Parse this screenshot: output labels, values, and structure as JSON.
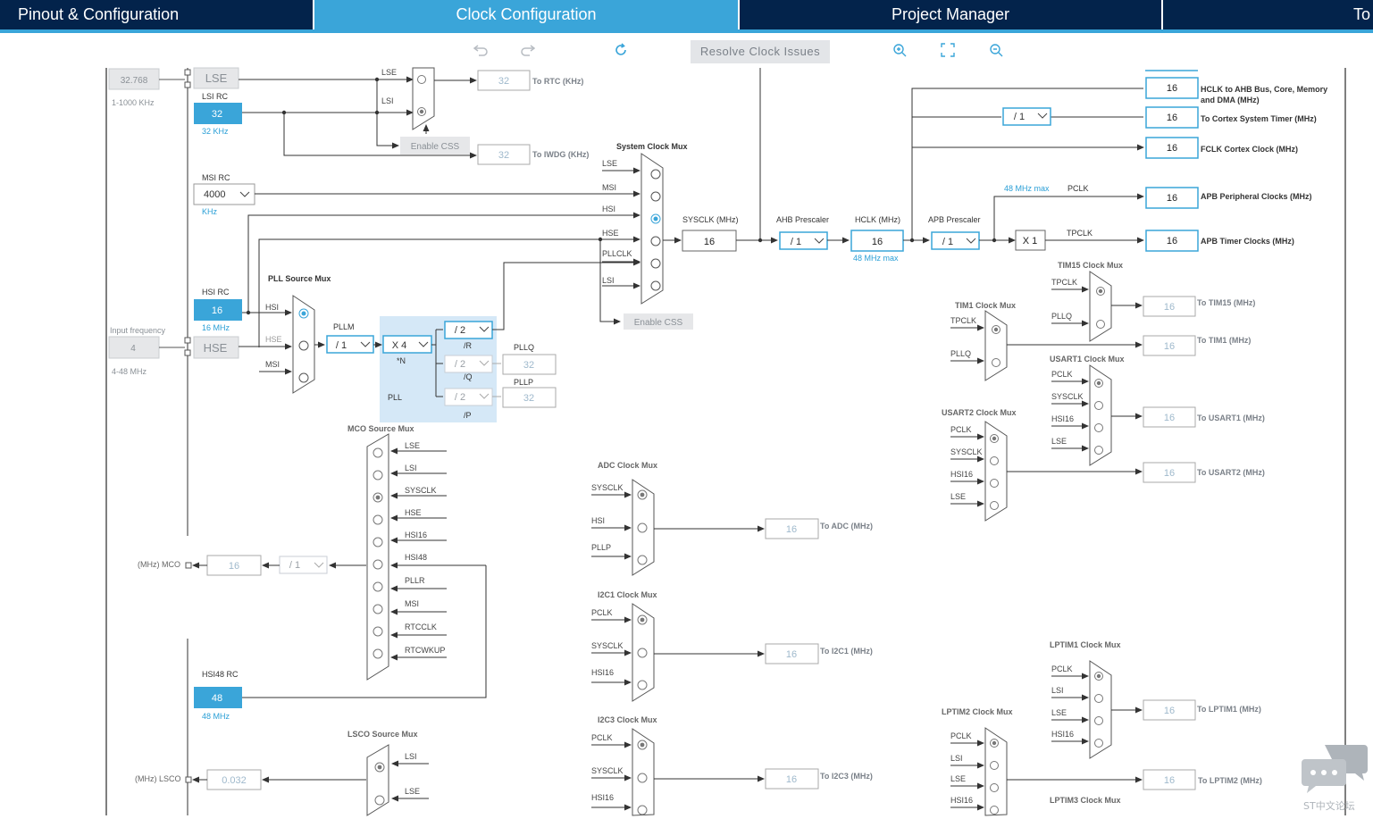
{
  "tabs": [
    {
      "label": "Pinout & Configuration",
      "active": false
    },
    {
      "label": "Clock Configuration",
      "active": true
    },
    {
      "label": "Project Manager",
      "active": false
    },
    {
      "label": "To",
      "active": false
    }
  ],
  "toolbar": {
    "undo_icon": "undo-icon",
    "redo_icon": "redo-icon",
    "reset_icon": "refresh-icon",
    "resolve_label": "Resolve Clock Issues",
    "zoom_in_icon": "zoom-in-icon",
    "fit_icon": "fit-screen-icon",
    "zoom_out_icon": "zoom-out-icon"
  },
  "sources": {
    "lse_value": "32.768",
    "lse_range": "1-1000 KHz",
    "lse_label": "LSE",
    "lsi_title": "LSI RC",
    "lsi_value": "32",
    "lsi_unit": "32 KHz",
    "msi_title": "MSI RC",
    "msi_value": "4000",
    "msi_unit": "KHz",
    "hsi_title": "HSI RC",
    "hsi_value": "16",
    "hsi_unit": "16 MHz",
    "input_freq_label": "Input frequency",
    "hse_value": "4",
    "hse_label": "HSE",
    "hse_range": "4-48 MHz",
    "hsi48_title": "HSI48 RC",
    "hsi48_value": "48",
    "hsi48_unit": "48 MHz"
  },
  "rtc": {
    "lse": "LSE",
    "lsi": "LSI",
    "value": "32",
    "label": "To RTC (KHz)",
    "enable_css": "Enable CSS",
    "iwdg_value": "32",
    "iwdg_label": "To IWDG (KHz)"
  },
  "sysmux": {
    "title": "System Clock Mux",
    "inputs": [
      "LSE",
      "MSI",
      "HSI",
      "HSE",
      "PLLCLK",
      "LSI"
    ],
    "enable_css": "Enable CSS"
  },
  "pll": {
    "src_title": "PLL Source Mux",
    "src_inputs": [
      "HSI",
      "HSE",
      "MSI"
    ],
    "pllm_label": "PLLM",
    "pllm_value": "/ 1",
    "pll_label": "PLL",
    "n_value": "X 4",
    "n_label": "*N",
    "r_value": "/ 2",
    "r_label": "/R",
    "q_value": "/ 2",
    "q_label": "/Q",
    "p_value": "/ 2",
    "p_label": "/P",
    "pllq_label": "PLLQ",
    "pllq_value": "32",
    "pllp_label": "PLLP",
    "pllp_value": "32"
  },
  "main": {
    "sysclk_label": "SYSCLK (MHz)",
    "sysclk_value": "16",
    "ahb_label": "AHB Prescaler",
    "ahb_value": "/ 1",
    "hclk_label": "HCLK (MHz)",
    "hclk_value": "16",
    "hclk_max": "48 MHz max",
    "apb_label": "APB Prescaler",
    "apb_value": "/ 1",
    "x1_label": "X 1",
    "pclk_max": "48 MHz max",
    "pclk": "PCLK",
    "tpclk": "TPCLK",
    "cortex_div": "/ 1"
  },
  "outputs": [
    {
      "value": "16",
      "label": "HCLK to AHB Bus, Core, Memory",
      "label2": "and DMA (MHz)"
    },
    {
      "value": "16",
      "label": "To Cortex System Timer (MHz)",
      "label2": ""
    },
    {
      "value": "16",
      "label": "FCLK Cortex Clock (MHz)",
      "label2": ""
    },
    {
      "value": "16",
      "label": "APB Peripheral Clocks (MHz)",
      "label2": ""
    },
    {
      "value": "16",
      "label": "APB Timer Clocks (MHz)",
      "label2": ""
    }
  ],
  "timers": {
    "tim15_title": "TIM15 Clock Mux",
    "tim15_inputs": [
      "TPCLK",
      "PLLQ"
    ],
    "tim15_value": "16",
    "tim15_label": "To TIM15 (MHz)",
    "tim1_title": "TIM1 Clock Mux",
    "tim1_inputs": [
      "TPCLK",
      "PLLQ"
    ],
    "tim1_value": "16",
    "tim1_label": "To TIM1 (MHz)",
    "usart1_title": "USART1 Clock Mux",
    "usart1_inputs": [
      "PCLK",
      "SYSCLK",
      "HSI16",
      "LSE"
    ],
    "usart1_value": "16",
    "usart1_label": "To USART1 (MHz)",
    "usart2_title": "USART2 Clock Mux",
    "usart2_inputs": [
      "PCLK",
      "SYSCLK",
      "HSI16",
      "LSE"
    ],
    "usart2_value": "16",
    "usart2_label": "To USART2 (MHz)",
    "lptim1_title": "LPTIM1 Clock Mux",
    "lptim1_inputs": [
      "PCLK",
      "LSI",
      "LSE",
      "HSI16"
    ],
    "lptim1_value": "16",
    "lptim1_label": "To LPTIM1 (MHz)",
    "lptim2_title": "LPTIM2 Clock Mux",
    "lptim2_inputs": [
      "PCLK",
      "LSI",
      "LSE",
      "HSI16"
    ],
    "lptim2_value": "16",
    "lptim2_label": "To LPTIM2 (MHz)",
    "lptim3_title": "LPTIM3 Clock Mux"
  },
  "mco": {
    "title": "MCO Source Mux",
    "inputs": [
      "LSE",
      "LSI",
      "SYSCLK",
      "HSE",
      "HSI16",
      "HSI48",
      "PLLR",
      "MSI",
      "RTCCLK",
      "RTCWKUP"
    ],
    "out_label": "(MHz) MCO",
    "out_value": "16",
    "div_value": "/ 1"
  },
  "lsco": {
    "title": "LSCO Source Mux",
    "inputs": [
      "LSI",
      "LSE"
    ],
    "out_label": "(MHz) LSCO",
    "out_value": "0.032"
  },
  "adc": {
    "title": "ADC Clock Mux",
    "inputs": [
      "SYSCLK",
      "HSI",
      "PLLP"
    ],
    "value": "16",
    "label": "To ADC (MHz)"
  },
  "i2c1": {
    "title": "I2C1 Clock Mux",
    "inputs": [
      "PCLK",
      "SYSCLK",
      "HSI16"
    ],
    "value": "16",
    "label": "To I2C1 (MHz)"
  },
  "i2c3": {
    "title": "I2C3 Clock Mux",
    "inputs": [
      "PCLK",
      "SYSCLK",
      "HSI16"
    ],
    "value": "16",
    "label": "To I2C3 (MHz)"
  },
  "watermark": {
    "text": "ST中文论坛",
    "icon": "chat-bubble-icon"
  },
  "colors": {
    "navy": "#03234b",
    "accent": "#3aa5d9",
    "blue_text": "#2a9fd6"
  }
}
